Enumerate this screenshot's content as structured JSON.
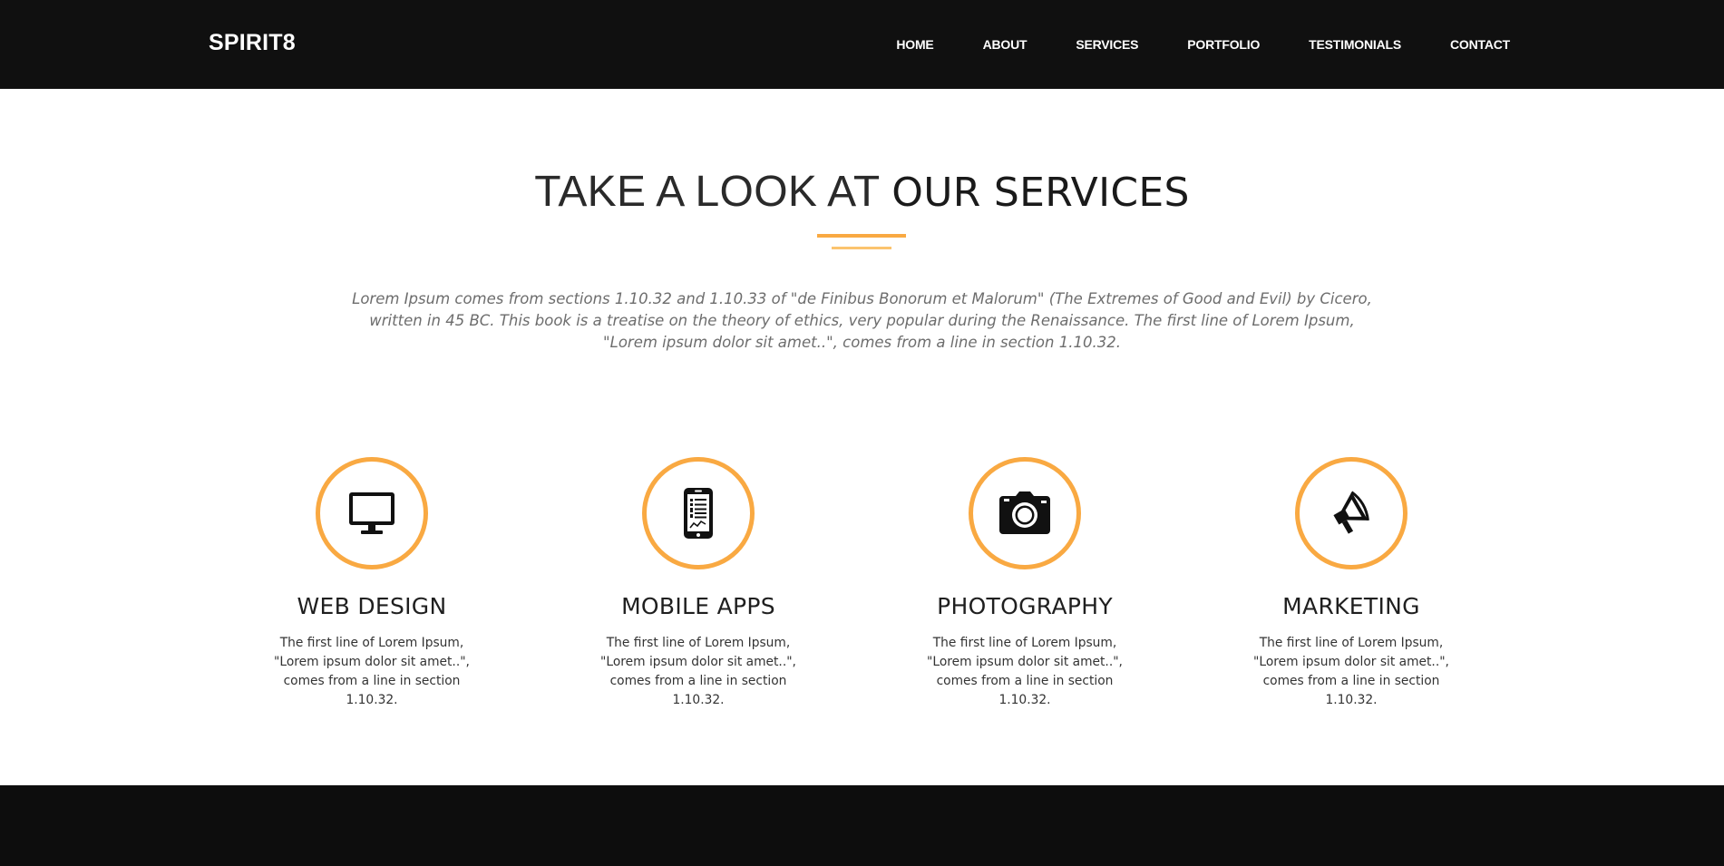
{
  "header": {
    "brand": "SPIRIT8",
    "nav": [
      "HOME",
      "ABOUT",
      "SERVICES",
      "PORTFOLIO",
      "TESTIMONIALS",
      "CONTACT"
    ]
  },
  "services_section": {
    "heading_light": "TAKE A LOOK AT ",
    "heading_strong": "OUR SERVICES",
    "intro": "Lorem Ipsum comes from sections 1.10.32 and 1.10.33 of \"de Finibus Bonorum et Malorum\" (The Extremes of Good and Evil) by Cicero, written in 45 BC. This book is a treatise on the theory of ethics, very popular during the Renaissance. The first line of Lorem Ipsum, \"Lorem ipsum dolor sit amet..\", comes from a line in section 1.10.32.",
    "items": [
      {
        "icon": "monitor-icon",
        "title": "WEB DESIGN",
        "text": "The first line of Lorem Ipsum, \"Lorem ipsum dolor sit amet..\", comes from a line in section 1.10.32."
      },
      {
        "icon": "mobile-phone-icon",
        "title": "MOBILE APPS",
        "text": "The first line of Lorem Ipsum, \"Lorem ipsum dolor sit amet..\", comes from a line in section 1.10.32."
      },
      {
        "icon": "camera-icon",
        "title": "PHOTOGRAPHY",
        "text": "The first line of Lorem Ipsum, \"Lorem ipsum dolor sit amet..\", comes from a line in section 1.10.32."
      },
      {
        "icon": "megaphone-icon",
        "title": "MARKETING",
        "text": "The first line of Lorem Ipsum, \"Lorem ipsum dolor sit amet..\", comes from a line in section 1.10.32."
      }
    ]
  },
  "colors": {
    "accent": "#f9a942",
    "header_bg": "#101010",
    "footer_bg": "#0d0d0d"
  }
}
